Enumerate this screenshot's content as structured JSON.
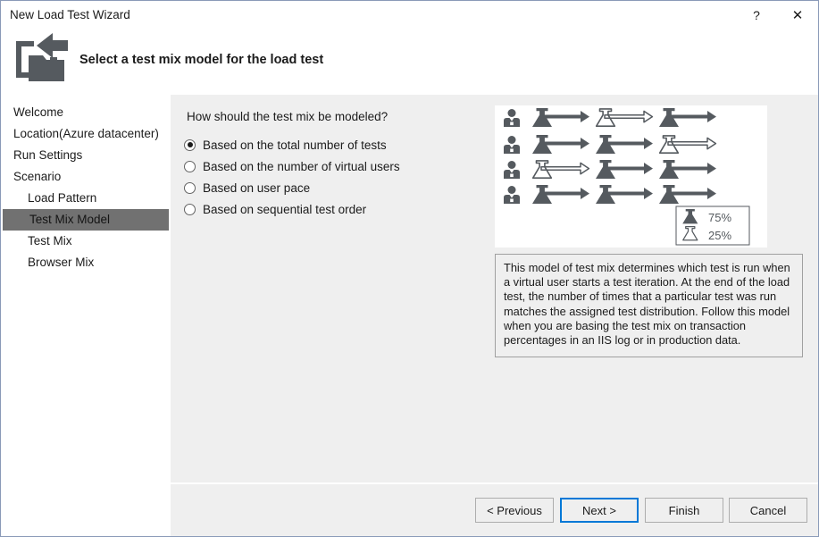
{
  "window": {
    "title": "New Load Test Wizard",
    "help_label": "?",
    "close_label": "✕",
    "header_title": "Select a test mix model for the load test",
    "header_icon": "import-folder-icon"
  },
  "sidebar": {
    "items": [
      {
        "label": "Welcome",
        "indent": false,
        "selected": false
      },
      {
        "label": "Location(Azure datacenter)",
        "indent": false,
        "selected": false
      },
      {
        "label": "Run Settings",
        "indent": false,
        "selected": false
      },
      {
        "label": "Scenario",
        "indent": false,
        "selected": false
      },
      {
        "label": "Load Pattern",
        "indent": true,
        "selected": false
      },
      {
        "label": "Test Mix Model",
        "indent": true,
        "selected": true
      },
      {
        "label": "Test Mix",
        "indent": true,
        "selected": false
      },
      {
        "label": "Browser Mix",
        "indent": true,
        "selected": false
      }
    ],
    "selected_color": "#717171"
  },
  "main": {
    "question": "How should the test mix be modeled?",
    "options": [
      {
        "label": "Based on the total number of tests",
        "checked": true
      },
      {
        "label": "Based on the number of virtual users",
        "checked": false
      },
      {
        "label": "Based on user pace",
        "checked": false
      },
      {
        "label": "Based on sequential test order",
        "checked": false
      }
    ],
    "description": "This model of test mix determines which test is run when a virtual user starts a test iteration. At the end of the load test, the number of times that a particular test was run matches the assigned test distribution. Follow this model when you are basing the test mix on transaction percentages in an IIS log or in production data."
  },
  "illustration": {
    "name": "test-mix-distribution-diagram",
    "rows": [
      {
        "user_icon": "user-icon",
        "steps": [
          "filled-flask",
          "outline-flask",
          "filled-flask"
        ]
      },
      {
        "user_icon": "user-icon",
        "steps": [
          "filled-flask",
          "filled-flask",
          "outline-flask"
        ]
      },
      {
        "user_icon": "user-icon",
        "steps": [
          "outline-flask",
          "filled-flask",
          "filled-flask"
        ]
      },
      {
        "user_icon": "user-icon",
        "steps": [
          "filled-flask",
          "filled-flask",
          "filled-flask"
        ]
      }
    ],
    "legend": [
      {
        "icon": "filled-flask",
        "value": "75%"
      },
      {
        "icon": "outline-flask",
        "value": "25%"
      }
    ],
    "ink_color": "#555a5f"
  },
  "footer": {
    "buttons": [
      {
        "label": "< Previous",
        "focused": false
      },
      {
        "label": "Next >",
        "focused": true
      },
      {
        "label": "Finish",
        "focused": false
      },
      {
        "label": "Cancel",
        "focused": false
      }
    ],
    "focus_color": "#0078d7"
  }
}
